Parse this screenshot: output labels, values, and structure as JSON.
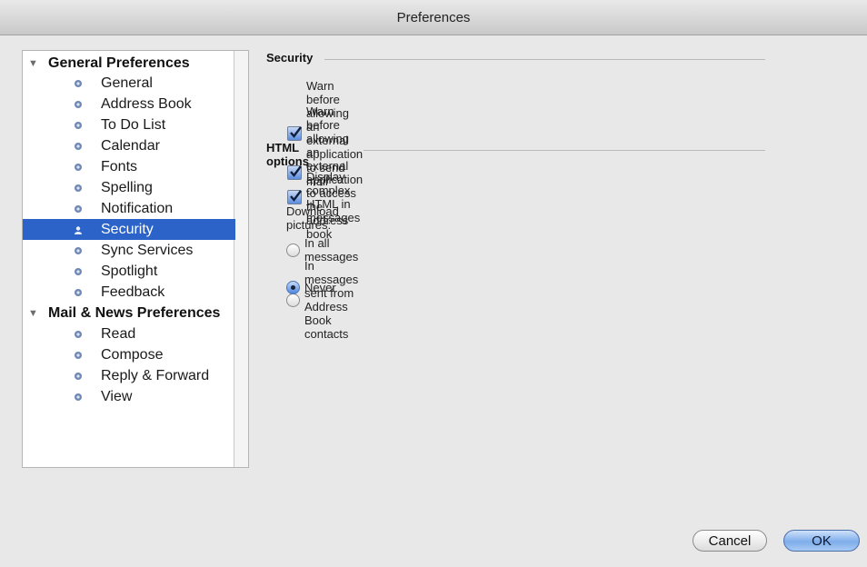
{
  "window": {
    "title": "Preferences"
  },
  "sidebar": {
    "groups": [
      {
        "label": "General Preferences",
        "items": [
          "General",
          "Address Book",
          "To Do List",
          "Calendar",
          "Fonts",
          "Spelling",
          "Notification",
          "Security",
          "Sync Services",
          "Spotlight",
          "Feedback"
        ]
      },
      {
        "label": "Mail & News Preferences",
        "items": [
          "Read",
          "Compose",
          "Reply & Forward",
          "View"
        ]
      }
    ],
    "selected": "Security"
  },
  "security": {
    "title": "Security",
    "warn_send_mail": {
      "label": "Warn before allowing an external application to send mail",
      "checked": true
    },
    "warn_address_book": {
      "label": "Warn before allowing an external application to access the address book",
      "checked": true
    }
  },
  "html_options": {
    "title": "HTML options",
    "display_complex": {
      "label": "Display complex HTML in messages",
      "checked": true
    },
    "download_label": "Download pictures:",
    "download_options": [
      "In all messages",
      "In messages sent from Address Book contacts",
      "Never"
    ],
    "download_selected": "Never"
  },
  "buttons": {
    "cancel": "Cancel",
    "ok": "OK"
  }
}
